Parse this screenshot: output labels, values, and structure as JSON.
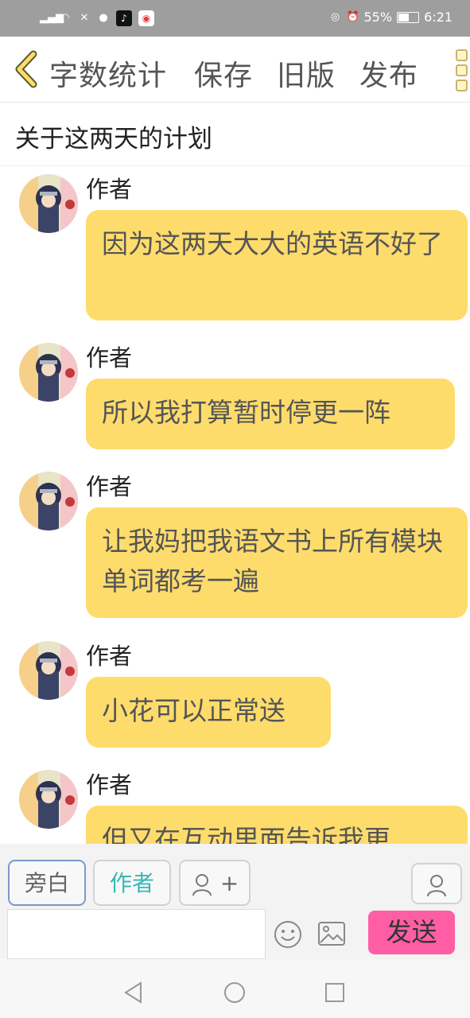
{
  "status_bar": {
    "signal_text": "⁴⁶",
    "battery_percent": "55%",
    "time": "6:21"
  },
  "toolbar": {
    "word_count": "字数统计",
    "save": "保存",
    "old_version": "旧版",
    "publish": "发布"
  },
  "story_title": "关于这两天的计划",
  "messages": [
    {
      "author": "作者",
      "text": "因为这两天大大的英语不好了"
    },
    {
      "author": "作者",
      "text": "所以我打算暂时停更一阵"
    },
    {
      "author": "作者",
      "text": "让我妈把我语文书上所有模块单词都考一遍"
    },
    {
      "author": "作者",
      "text": "小花可以正常送"
    },
    {
      "author": "作者",
      "text": "但又在互动里面告诉我更"
    }
  ],
  "composer": {
    "narration_label": "旁白",
    "author_label": "作者",
    "add_role_label": "+",
    "send_label": "发送",
    "input_value": "",
    "input_placeholder": ""
  },
  "colors": {
    "bubble": "#fedc6c",
    "send_button": "#ff5ea4",
    "author_accent": "#35b9b6",
    "status_bar": "#9e9e9e"
  }
}
